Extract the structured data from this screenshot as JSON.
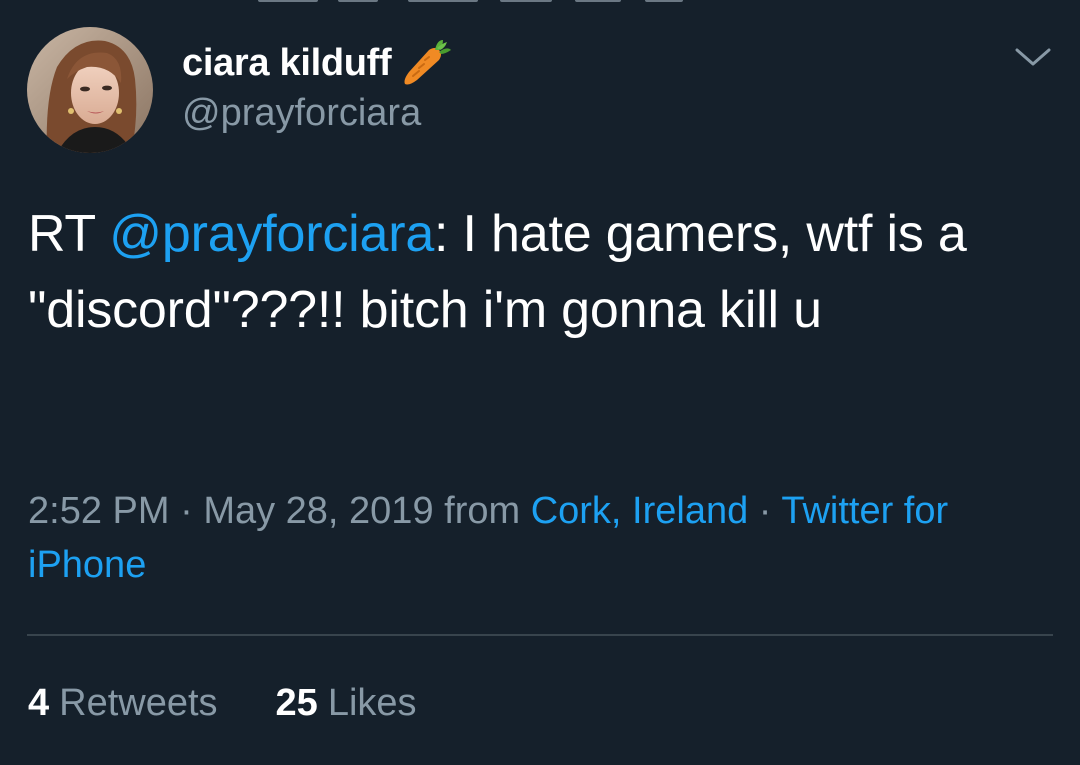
{
  "colors": {
    "background": "#15202b",
    "text_primary": "#ffffff",
    "text_secondary": "#8899a6",
    "accent": "#1da1f2",
    "divider": "#38444d"
  },
  "tweet": {
    "author": {
      "display_name": "ciara kilduff",
      "name_emoji": "carrot-icon",
      "handle": "@prayforciara",
      "avatar": "avatar-photo"
    },
    "menu_icon": "chevron-down-icon",
    "text": {
      "prefix": "RT ",
      "mention": "@prayforciara",
      "body": ": I hate gamers, wtf is a \"discord\"???!! bitch i'm gonna kill u"
    },
    "meta": {
      "time": "2:52 PM",
      "sep1": " · ",
      "date": "May 28, 2019",
      "from_label": " from ",
      "location": "Cork, Ireland",
      "sep2": " · ",
      "source": "Twitter for iPhone"
    },
    "stats": {
      "retweets_count": "4",
      "retweets_label": "Retweets",
      "likes_count": "25",
      "likes_label": "Likes"
    }
  }
}
